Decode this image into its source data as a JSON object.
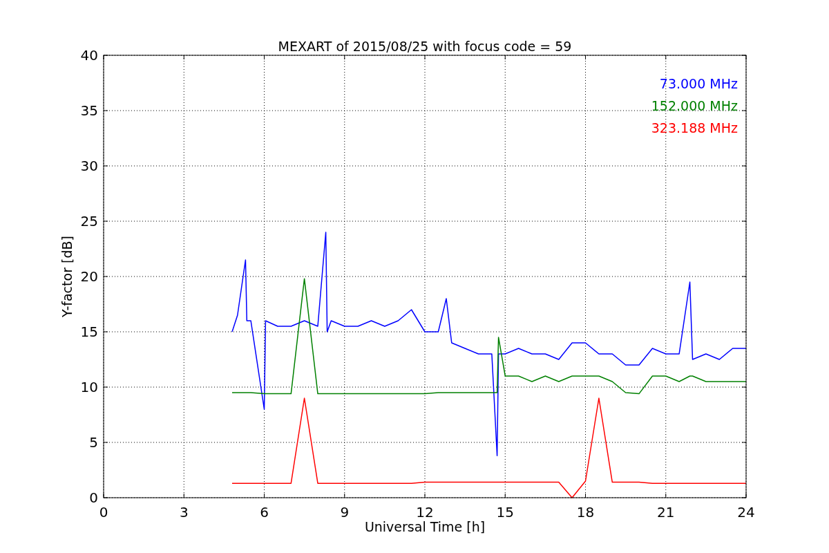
{
  "figure": {
    "chart_data": {
      "type": "line",
      "title": "MEXART of 2015/08/25 with focus code = 59",
      "xlabel": "Universal Time [h]",
      "ylabel": "Y-factor [dB]",
      "x": [
        4.8,
        5.0,
        5.3,
        5.35,
        5.5,
        6.0,
        6.05,
        6.5,
        7.0,
        7.5,
        8.0,
        8.3,
        8.35,
        8.5,
        9.0,
        9.5,
        10.0,
        10.5,
        11.0,
        11.5,
        12.0,
        12.5,
        12.8,
        13.0,
        13.5,
        14.0,
        14.5,
        14.7,
        14.75,
        15.0,
        15.5,
        16.0,
        16.5,
        17.0,
        17.5,
        18.0,
        18.5,
        19.0,
        19.5,
        20.0,
        20.5,
        21.0,
        21.5,
        21.9,
        22.0,
        22.5,
        23.0,
        23.5,
        24.0
      ],
      "series": [
        {
          "name": "73.000 MHz",
          "color": "#0000ff",
          "values": [
            15,
            16.5,
            21.5,
            16,
            16,
            8,
            16,
            15.5,
            15.5,
            16,
            15.5,
            24,
            15,
            16,
            15.5,
            15.5,
            16,
            15.5,
            16,
            17,
            15,
            15,
            18,
            14,
            13.5,
            13,
            13,
            3.8,
            13,
            13,
            13.5,
            13,
            13,
            12.5,
            14,
            14,
            13,
            13,
            12,
            12,
            13.5,
            13,
            13,
            19.5,
            12.5,
            13,
            12.5,
            13.5,
            13.5
          ]
        },
        {
          "name": "152.000 MHz",
          "color": "#008000",
          "values": [
            9.5,
            9.5,
            9.5,
            9.5,
            9.5,
            9.4,
            9.4,
            9.4,
            9.4,
            19.8,
            9.4,
            9.4,
            9.4,
            9.4,
            9.4,
            9.4,
            9.4,
            9.4,
            9.4,
            9.4,
            9.4,
            9.5,
            9.5,
            9.5,
            9.5,
            9.5,
            9.5,
            9.5,
            14.5,
            11,
            11,
            10.5,
            11,
            10.5,
            11,
            11,
            11,
            10.5,
            9.5,
            9.4,
            11,
            11,
            10.5,
            11,
            11,
            10.5,
            10.5,
            10.5,
            10.5
          ]
        },
        {
          "name": "323.188 MHz",
          "color": "#ff0000",
          "values": [
            1.3,
            1.3,
            1.3,
            1.3,
            1.3,
            1.3,
            1.3,
            1.3,
            1.3,
            9.0,
            1.3,
            1.3,
            1.3,
            1.3,
            1.3,
            1.3,
            1.3,
            1.3,
            1.3,
            1.3,
            1.4,
            1.4,
            1.4,
            1.4,
            1.4,
            1.4,
            1.4,
            1.4,
            1.4,
            1.4,
            1.4,
            1.4,
            1.4,
            1.4,
            0,
            1.5,
            9,
            1.4,
            1.4,
            1.4,
            1.3,
            1.3,
            1.3,
            1.3,
            1.3,
            1.3,
            1.3,
            1.3,
            1.3
          ]
        }
      ],
      "xlim": [
        0,
        24
      ],
      "ylim": [
        0,
        40
      ],
      "xticks": [
        0,
        3,
        6,
        9,
        12,
        15,
        18,
        21,
        24
      ],
      "yticks": [
        0,
        5,
        10,
        15,
        20,
        25,
        30,
        35,
        40
      ],
      "grid": true
    }
  }
}
